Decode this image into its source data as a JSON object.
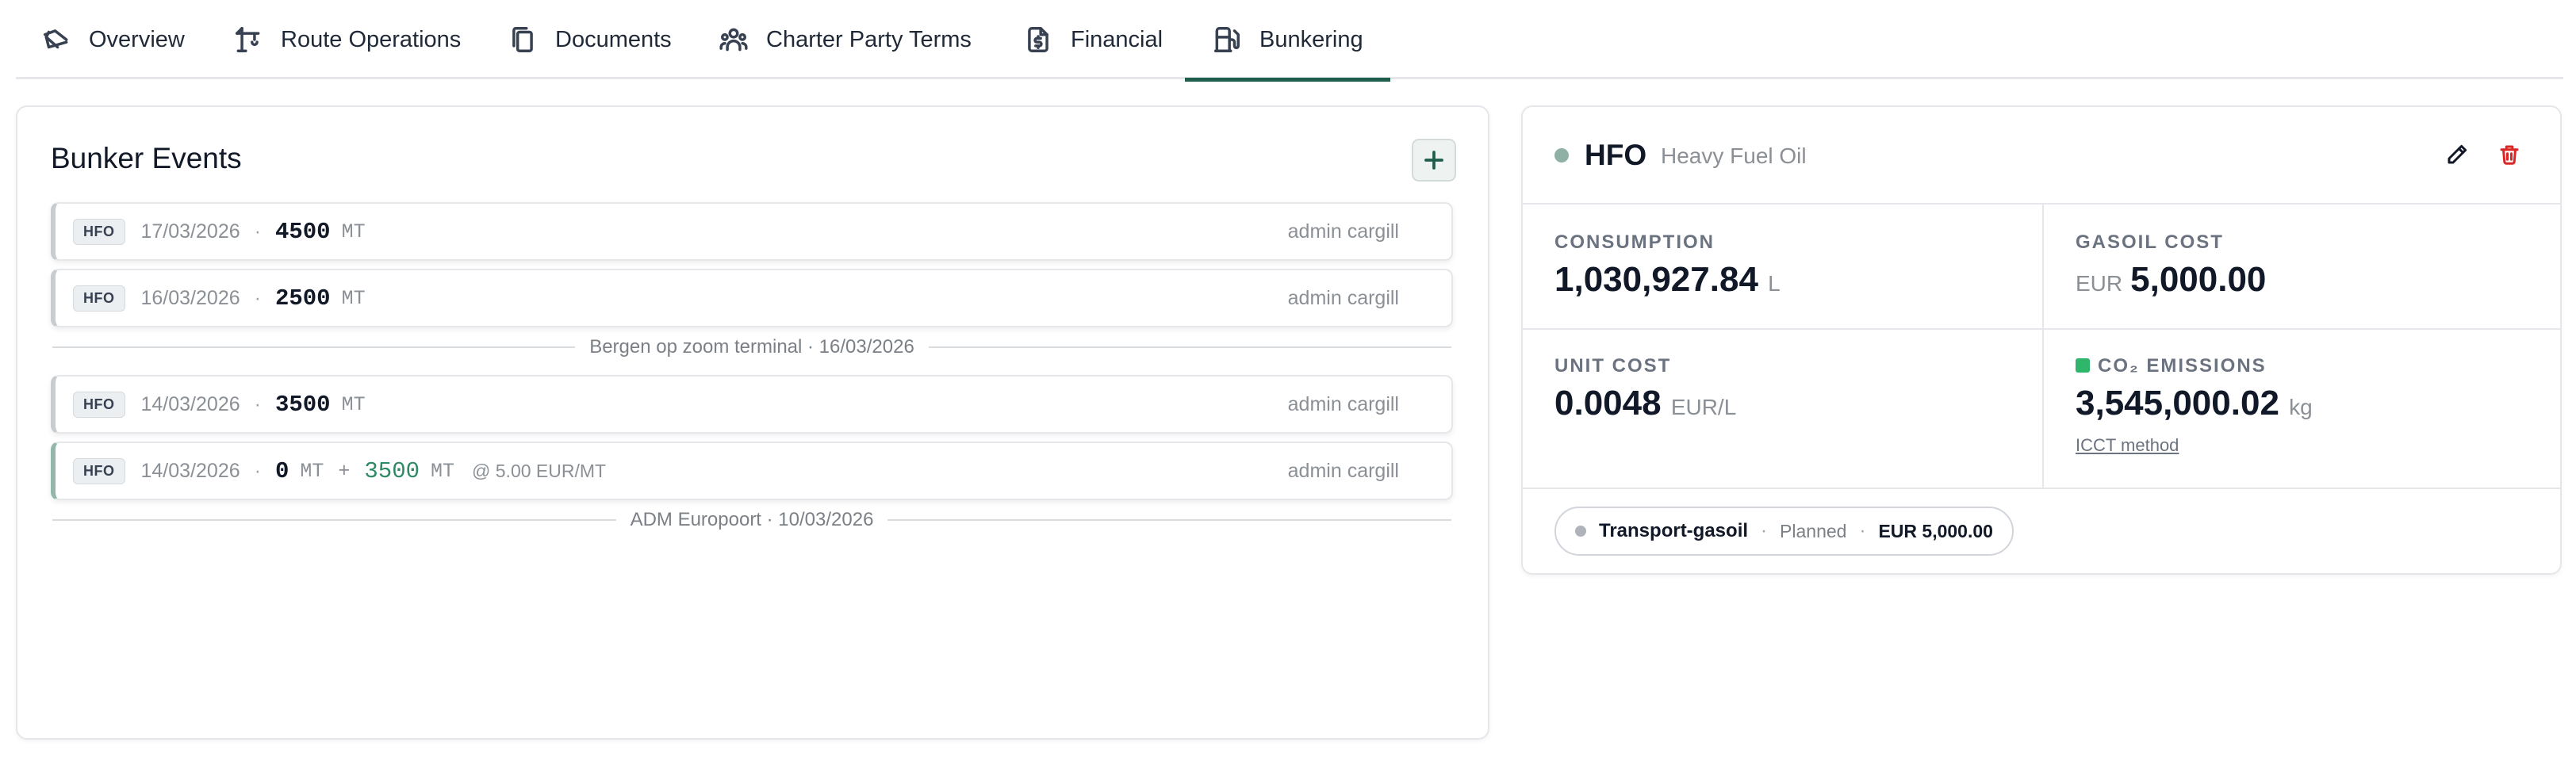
{
  "tabs": [
    {
      "label": "Overview",
      "icon": "ship-icon",
      "active": false
    },
    {
      "label": "Route Operations",
      "icon": "crane-icon",
      "active": false
    },
    {
      "label": "Documents",
      "icon": "documents-icon",
      "active": false
    },
    {
      "label": "Charter Party Terms",
      "icon": "users-icon",
      "active": false
    },
    {
      "label": "Financial",
      "icon": "dollar-file-icon",
      "active": false
    },
    {
      "label": "Bunkering",
      "icon": "fuel-pump-icon",
      "active": true
    }
  ],
  "events_panel": {
    "title": "Bunker Events",
    "add_icon": "plus-icon",
    "events": [
      {
        "fuel": "HFO",
        "date": "17/03/2026",
        "sep": "·",
        "qty": "4500",
        "unit": "MT",
        "user": "admin cargill"
      },
      {
        "fuel": "HFO",
        "date": "16/03/2026",
        "sep": "·",
        "qty": "2500",
        "unit": "MT",
        "user": "admin cargill"
      },
      {
        "fuel": "HFO",
        "date": "14/03/2026",
        "sep": "·",
        "qty": "3500",
        "unit": "MT",
        "user": "admin cargill"
      },
      {
        "fuel": "HFO",
        "date": "14/03/2026",
        "sep": "·",
        "qty": "0",
        "unit": "MT",
        "plus": "+",
        "added_qty": "3500",
        "added_unit": "MT",
        "price": "@ 5.00 EUR/MT",
        "user": "admin cargill"
      }
    ],
    "dividers": [
      {
        "text": "Bergen op zoom terminal · 16/03/2026"
      },
      {
        "text": "ADM Europoort · 10/03/2026"
      }
    ]
  },
  "fuel_panel": {
    "code": "HFO",
    "name": "Heavy Fuel Oil",
    "status_color": "#8fb0a5",
    "edit_icon": "pencil-icon",
    "delete_icon": "trash-icon",
    "consumption": {
      "label": "CONSUMPTION",
      "value": "1,030,927.84",
      "unit": "L"
    },
    "gasoil_cost": {
      "label": "GASOIL COST",
      "currency": "EUR",
      "value": "5,000.00"
    },
    "unit_cost": {
      "label": "UNIT COST",
      "value": "0.0048",
      "unit": "EUR/L"
    },
    "co2": {
      "label": "CO₂ EMISSIONS",
      "value": "3,545,000.02",
      "unit": "kg",
      "method": "ICCT method",
      "indicator_color": "#2fb66c"
    },
    "purchase": {
      "name": "Transport-gasoil",
      "sep": "·",
      "status": "Planned",
      "amount": "EUR 5,000.00"
    }
  },
  "colors": {
    "accent": "#1f5e4c",
    "added_qty": "#2e8a65",
    "delete": "#dc2626"
  }
}
